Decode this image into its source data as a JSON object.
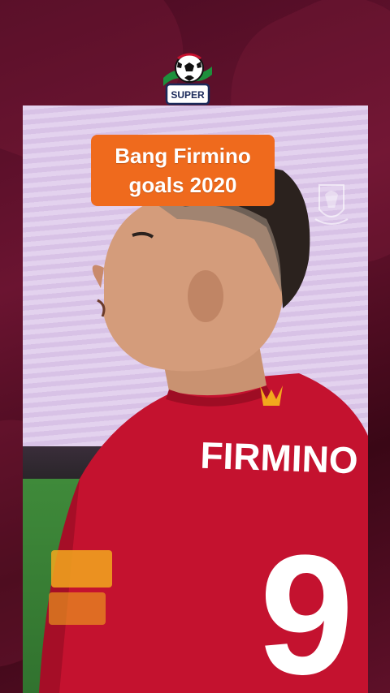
{
  "logo": {
    "text": "SUPER",
    "icon": "soccer-ball-icon"
  },
  "caption": {
    "line1": "Bang Firmino",
    "line2": "goals 2020"
  },
  "video": {
    "player_name": "FIRMINO",
    "player_number": "9",
    "colors": {
      "kit": "#c8102e",
      "caption_bg": "#ef6a1d",
      "sleeve_sponsor": "#f2a81d"
    }
  }
}
